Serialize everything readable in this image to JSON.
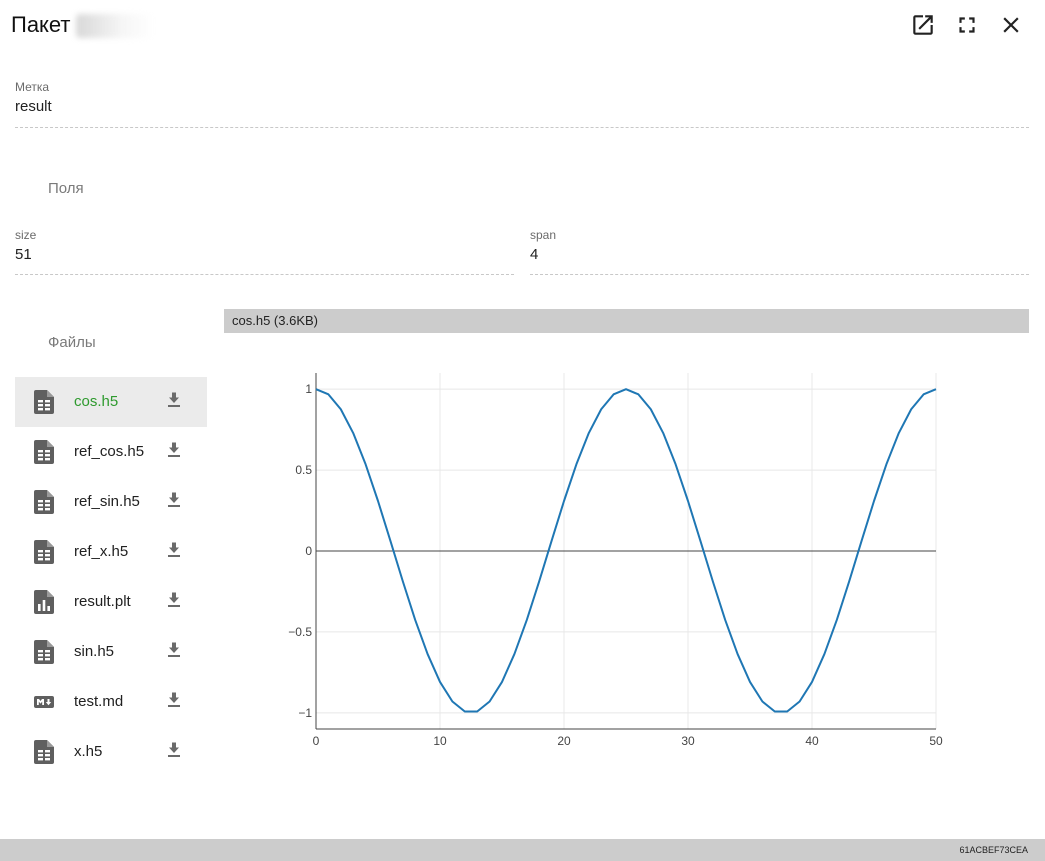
{
  "dialog": {
    "title": "Пакет",
    "title_redacted": true,
    "buttons": {
      "open_external": "open-in-new-icon",
      "fullscreen": "fullscreen-icon",
      "close": "close-icon"
    }
  },
  "label_field": {
    "label": "Метка",
    "value": "result"
  },
  "fields_section": {
    "title": "Поля",
    "fields": [
      {
        "label": "size",
        "value": "51"
      },
      {
        "label": "span",
        "value": "4"
      }
    ]
  },
  "files_section": {
    "title": "Файлы",
    "active_index": 0,
    "active_color": "#2e9a2e",
    "files": [
      {
        "name": "cos.h5",
        "icon": "spreadsheet-file-icon"
      },
      {
        "name": "ref_cos.h5",
        "icon": "spreadsheet-file-icon"
      },
      {
        "name": "ref_sin.h5",
        "icon": "spreadsheet-file-icon"
      },
      {
        "name": "ref_x.h5",
        "icon": "spreadsheet-file-icon"
      },
      {
        "name": "result.plt",
        "icon": "chart-file-icon"
      },
      {
        "name": "sin.h5",
        "icon": "spreadsheet-file-icon"
      },
      {
        "name": "test.md",
        "icon": "markdown-icon"
      },
      {
        "name": "x.h5",
        "icon": "spreadsheet-file-icon"
      }
    ]
  },
  "preview": {
    "header": "cos.h5 (3.6KB)"
  },
  "chart_data": {
    "type": "line",
    "title": "",
    "xlabel": "",
    "ylabel": "",
    "xlim": [
      0,
      50
    ],
    "ylim": [
      -1.1,
      1.1
    ],
    "xticks": [
      0,
      10,
      20,
      30,
      40,
      50
    ],
    "yticks": [
      1,
      0.5,
      0,
      -0.5,
      -1
    ],
    "ytick_labels": [
      "1",
      "0.5",
      "0",
      "−0.5",
      "−1"
    ],
    "grid": true,
    "zero_line": true,
    "line_color": "#1f77b4",
    "series": [
      {
        "x": [
          0,
          1,
          2,
          3,
          4,
          5,
          6,
          7,
          8,
          9,
          10,
          11,
          12,
          13,
          14,
          15,
          16,
          17,
          18,
          19,
          20,
          21,
          22,
          23,
          24,
          25,
          26,
          27,
          28,
          29,
          30,
          31,
          32,
          33,
          34,
          35,
          36,
          37,
          38,
          39,
          40,
          41,
          42,
          43,
          44,
          45,
          46,
          47,
          48,
          49,
          50
        ],
        "values": [
          1,
          0.968,
          0.876,
          0.729,
          0.536,
          0.309,
          0.063,
          -0.187,
          -0.426,
          -0.637,
          -0.809,
          -0.93,
          -0.992,
          -0.992,
          -0.93,
          -0.809,
          -0.637,
          -0.426,
          -0.187,
          0.063,
          0.309,
          0.536,
          0.729,
          0.876,
          0.968,
          1,
          0.968,
          0.876,
          0.729,
          0.536,
          0.309,
          0.063,
          -0.187,
          -0.426,
          -0.637,
          -0.809,
          -0.93,
          -0.992,
          -0.992,
          -0.93,
          -0.809,
          -0.637,
          -0.426,
          -0.187,
          0.063,
          0.309,
          0.536,
          0.729,
          0.876,
          0.968,
          1
        ]
      }
    ]
  },
  "status": {
    "id": "61ACBEF73CEA"
  }
}
